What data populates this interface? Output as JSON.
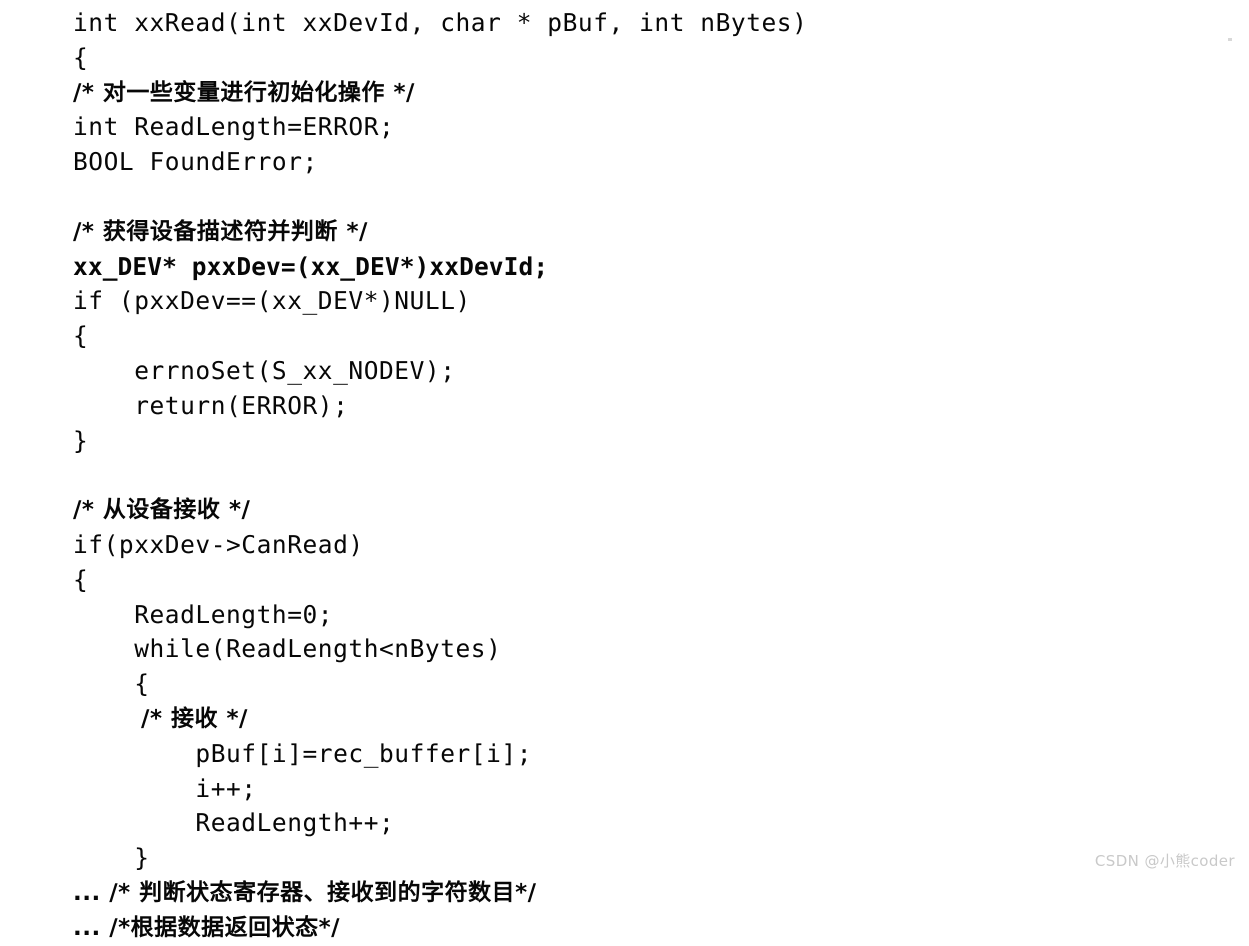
{
  "document": {
    "kind": "scanned-code-listing",
    "language": "C",
    "background_color": "#ffffff",
    "text_color": "#070707"
  },
  "code": {
    "lines": [
      {
        "text": "int xxRead(int xxDevId, char * pBuf, int nBytes)",
        "style": "mono"
      },
      {
        "text": "{",
        "style": "mono"
      },
      {
        "text": "/* 对一些变量进行初始化操作 */",
        "style": "cjk"
      },
      {
        "text": "int ReadLength=ERROR;",
        "style": "mono"
      },
      {
        "text": "BOOL FoundError;",
        "style": "mono"
      },
      {
        "text": "",
        "style": "blank"
      },
      {
        "text": "/* 获得设备描述符并判断 */",
        "style": "cjk"
      },
      {
        "text": "xx_DEV* pxxDev=(xx_DEV*)xxDevId;",
        "style": "bold"
      },
      {
        "text": "if (pxxDev==(xx_DEV*)NULL)",
        "style": "mono"
      },
      {
        "text": "{",
        "style": "mono"
      },
      {
        "text": "    errnoSet(S_xx_NODEV);",
        "style": "mono"
      },
      {
        "text": "    return(ERROR);",
        "style": "mono"
      },
      {
        "text": "}",
        "style": "mono"
      },
      {
        "text": "",
        "style": "blank"
      },
      {
        "text": "/* 从设备接收 */",
        "style": "cjk"
      },
      {
        "text": "if(pxxDev->CanRead)",
        "style": "mono"
      },
      {
        "text": "{",
        "style": "mono"
      },
      {
        "text": "    ReadLength=0;",
        "style": "mono"
      },
      {
        "text": "    while(ReadLength<nBytes)",
        "style": "mono"
      },
      {
        "text": "    {",
        "style": "mono"
      },
      {
        "text": "        /* 接收 */",
        "style": "cjk"
      },
      {
        "text": "        pBuf[i]=rec_buffer[i];",
        "style": "mono"
      },
      {
        "text": "        i++;",
        "style": "mono"
      },
      {
        "text": "        ReadLength++;",
        "style": "mono"
      },
      {
        "text": "    }",
        "style": "mono"
      },
      {
        "text": "... /* 判断状态寄存器、接收到的字符数目*/",
        "style": "cjk"
      },
      {
        "text": "... /*根据数据返回状态*/",
        "style": "cjk"
      }
    ]
  },
  "watermark": {
    "text": "CSDN @小熊coder",
    "color": "#c9c9c9"
  }
}
